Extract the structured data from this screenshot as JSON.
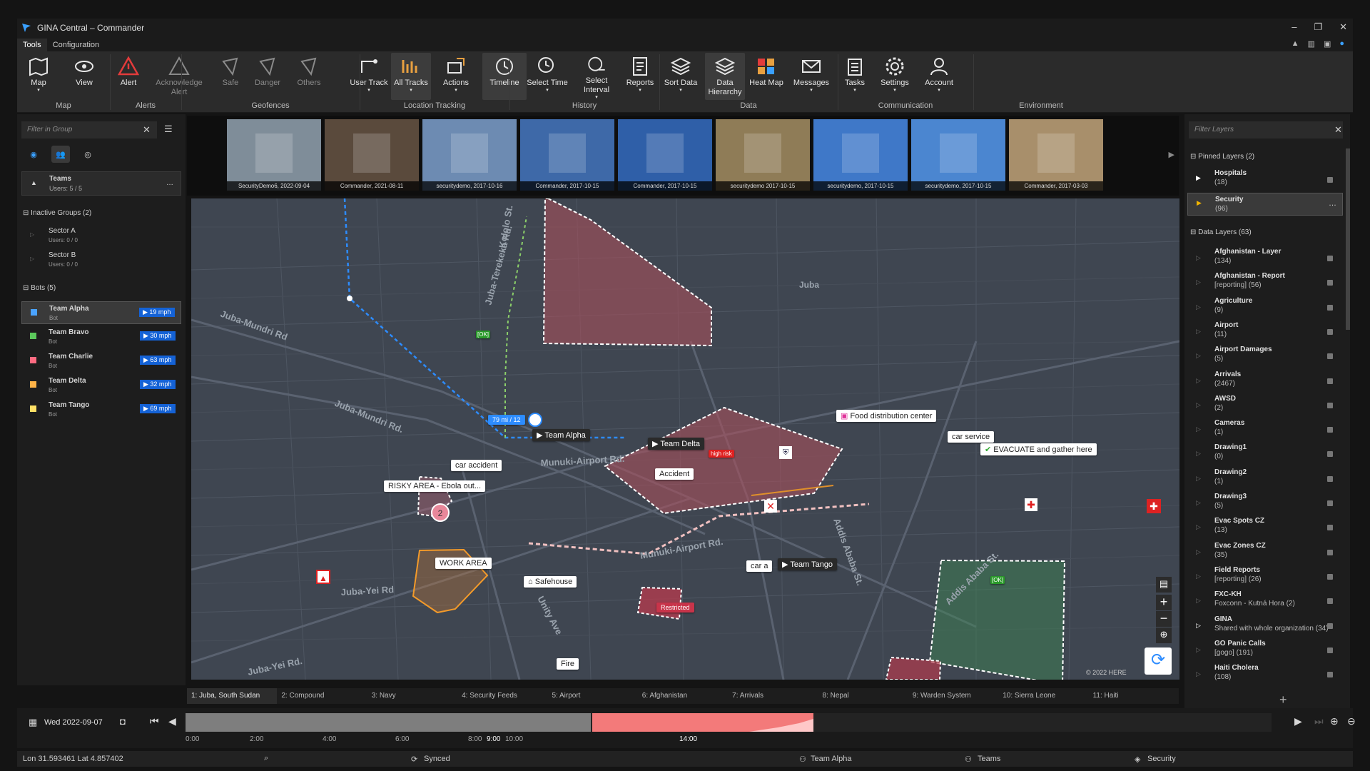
{
  "window": {
    "title": "GINA Central – Commander",
    "controls": [
      "–",
      "❐",
      "✕"
    ]
  },
  "menu": {
    "tabs": [
      "Tools",
      "Configuration"
    ]
  },
  "ribbon": {
    "buttons": [
      {
        "id": "map",
        "label": "Map",
        "icon": "map-icon"
      },
      {
        "id": "view",
        "label": "View",
        "icon": "eye-icon"
      },
      {
        "id": "alert",
        "label": "Alert",
        "icon": "alert-triangle-icon"
      },
      {
        "id": "ack",
        "label": "Acknowledge Alert",
        "icon": "warning-outline-icon"
      },
      {
        "id": "safe",
        "label": "Safe",
        "icon": "polygon-icon"
      },
      {
        "id": "danger",
        "label": "Danger",
        "icon": "polygon-icon"
      },
      {
        "id": "others",
        "label": "Others",
        "icon": "polygon-icon"
      },
      {
        "id": "usertrack",
        "label": "User Track",
        "icon": "user-track-icon"
      },
      {
        "id": "alltracks",
        "label": "All Tracks",
        "icon": "all-tracks-icon"
      },
      {
        "id": "actions",
        "label": "Actions",
        "icon": "actions-icon"
      },
      {
        "id": "timeline",
        "label": "Timeline",
        "icon": "timeline-icon"
      },
      {
        "id": "selecttime",
        "label": "Select Time",
        "icon": "select-time-icon"
      },
      {
        "id": "selectinterval",
        "label": "Select Interval",
        "icon": "select-interval-icon"
      },
      {
        "id": "reports",
        "label": "Reports",
        "icon": "reports-icon"
      },
      {
        "id": "sortdata",
        "label": "Sort Data",
        "icon": "layers-icon"
      },
      {
        "id": "datahierarchy",
        "label": "Data Hierarchy",
        "icon": "layers-icon"
      },
      {
        "id": "heatmap",
        "label": "Heat Map",
        "icon": "heat-map-icon"
      },
      {
        "id": "messages",
        "label": "Messages",
        "icon": "envelope-icon"
      },
      {
        "id": "tasks",
        "label": "Tasks",
        "icon": "clipboard-icon"
      },
      {
        "id": "settings",
        "label": "Settings",
        "icon": "gear-icon"
      },
      {
        "id": "account",
        "label": "Account",
        "icon": "user-icon"
      }
    ],
    "groups": [
      "Map",
      "Alerts",
      "Geofences",
      "Location Tracking",
      "History",
      "Data",
      "Communication",
      "Environment"
    ]
  },
  "left": {
    "filter_placeholder": "Filter in Group",
    "teams": {
      "title": "Teams",
      "users": "Users: 5 / 5"
    },
    "inactive_header": "Inactive Groups (2)",
    "inactive": [
      {
        "name": "Sector A",
        "users": "Users: 0 / 0"
      },
      {
        "name": "Sector B",
        "users": "Users: 0 / 0"
      }
    ],
    "bots_header": "Bots (5)",
    "bots": [
      {
        "name": "Team Alpha",
        "sub": "Bot",
        "speed": "19 mph",
        "color": "#4aa3ff"
      },
      {
        "name": "Team Bravo",
        "sub": "Bot",
        "speed": "30 mph",
        "color": "#5cc85c"
      },
      {
        "name": "Team Charlie",
        "sub": "Bot",
        "speed": "63 mph",
        "color": "#ff6b81"
      },
      {
        "name": "Team Delta",
        "sub": "Bot",
        "speed": "32 mph",
        "color": "#ffb347"
      },
      {
        "name": "Team Tango",
        "sub": "Bot",
        "speed": "69 mph",
        "color": "#ffe066"
      }
    ]
  },
  "thumbnails": [
    {
      "caption": "SecurityDemo6, 2022-09-04",
      "bg": "#7f8d99"
    },
    {
      "caption": "Commander, 2021-08-11",
      "bg": "#5a4a3c"
    },
    {
      "caption": "securitydemo, 2017-10-16",
      "bg": "#6d8bb2"
    },
    {
      "caption": "Commander, 2017-10-15",
      "bg": "#3e69a8"
    },
    {
      "caption": "Commander, 2017-10-15",
      "bg": "#2f5fa8"
    },
    {
      "caption": "securitydemo 2017-10-15",
      "bg": "#8f7c57"
    },
    {
      "caption": "securitydemo, 2017-10-15",
      "bg": "#3f78c8"
    },
    {
      "caption": "securitydemo, 2017-10-15",
      "bg": "#4b86d0"
    },
    {
      "caption": "Commander, 2017-03-03",
      "bg": "#a88f6b"
    }
  ],
  "map": {
    "labels": {
      "juba": "Juba",
      "team_alpha": "Team Alpha",
      "team_delta": "Team Delta",
      "team_tango": "Team Tango",
      "car_accident": "car accident",
      "risky": "RISKY AREA - Ebola out...",
      "accident": "Accident",
      "high_risk": "high risk",
      "food": "Food distribution center",
      "car_service": "car service",
      "evacuate": "EVACUATE and gather here",
      "work_area": "WORK AREA",
      "safehouse": "Safehouse",
      "restricted": "Restricted",
      "fire": "Fire",
      "car_a": "car a",
      "speed": "79 mi / 12",
      "ok1": "[OK]",
      "ok2": "[OK]",
      "cluster": "2",
      "copyright": "© 2022 HERE"
    },
    "roads": [
      "Juba-Mundri Rd",
      "Juba-Mundri Rd.",
      "Munuki-Airport Rd.",
      "Munuki-Airport Rd.",
      "Juba-Yei Rd",
      "Juba-Yei Rd.",
      "Unity Ave",
      "Addis Ababa St.",
      "Addis Ababa St.",
      "Juba-Terekeka Rd.",
      "Kololo St."
    ]
  },
  "map_tabs": [
    "1: Juba, South Sudan",
    "2: Compound",
    "3: Navy",
    "4: Security Feeds",
    "5: Airport",
    "6: Afghanistan",
    "7: Arrivals",
    "8: Nepal",
    "9: Warden System",
    "10: Sierra Leone",
    "11: Haiti"
  ],
  "right": {
    "filter_placeholder": "Filter Layers",
    "pinned_header": "Pinned Layers (2)",
    "pinned": [
      {
        "name": "Hospitals",
        "count": "(18)"
      },
      {
        "name": "Security",
        "count": "(96)"
      }
    ],
    "data_header": "Data Layers (63)",
    "layers": [
      {
        "name": "Afghanistan - Layer",
        "count": "(134)"
      },
      {
        "name": "Afghanistan - Report",
        "count": "[reporting] (56)"
      },
      {
        "name": "Agriculture",
        "count": "(9)"
      },
      {
        "name": "Airport",
        "count": "(11)"
      },
      {
        "name": "Airport Damages",
        "count": "(5)"
      },
      {
        "name": "Arrivals",
        "count": "(2467)"
      },
      {
        "name": "AWSD",
        "count": "(2)"
      },
      {
        "name": "Cameras",
        "count": "(1)"
      },
      {
        "name": "Drawing1",
        "count": "(0)"
      },
      {
        "name": "Drawing2",
        "count": "(1)"
      },
      {
        "name": "Drawing3",
        "count": "(5)"
      },
      {
        "name": "Evac Spots CZ",
        "count": "(13)"
      },
      {
        "name": "Evac Zones CZ",
        "count": "(35)"
      },
      {
        "name": "Field Reports",
        "count": "[reporting] (26)"
      },
      {
        "name": "FXC-KH",
        "count": "Foxconn - Kutná Hora (2)"
      },
      {
        "name": "GINA",
        "count": "Shared with whole organization (34)"
      },
      {
        "name": "GO Panic Calls",
        "count": "[gogo] (191)"
      },
      {
        "name": "Haiti Cholera",
        "count": "(108)"
      }
    ]
  },
  "timeline": {
    "date": "Wed 2022-09-07",
    "ticks": [
      "0:00",
      "2:00",
      "4:00",
      "6:00",
      "8:00",
      "9:00",
      "10:00",
      "14:00"
    ]
  },
  "status": {
    "coords": "Lon 31.593461 Lat 4.857402",
    "synced": "Synced",
    "user": "Team Alpha",
    "group": "Teams",
    "layer": "Security"
  }
}
